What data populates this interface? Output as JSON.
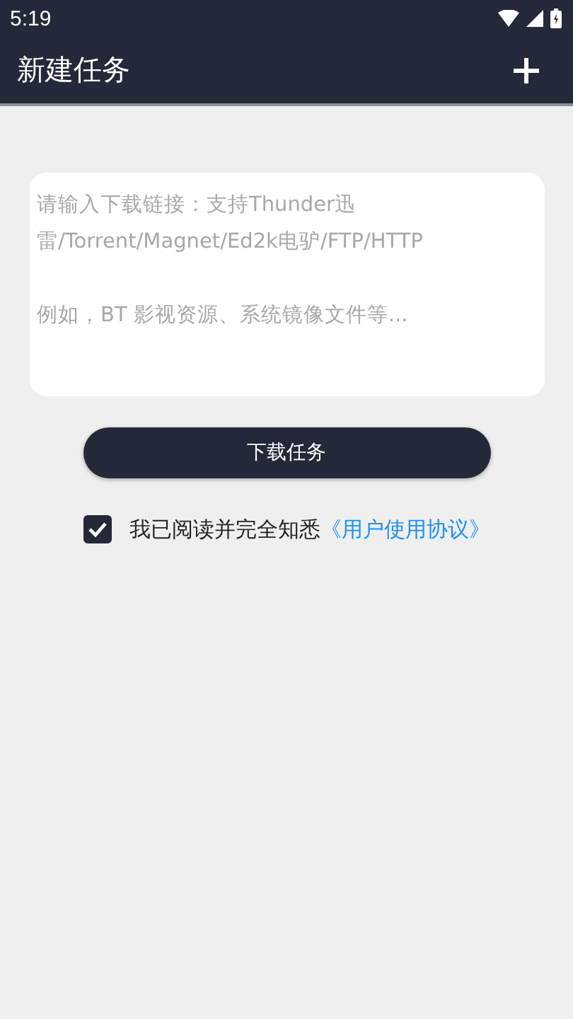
{
  "status_bar": {
    "time": "5:19"
  },
  "app_bar": {
    "title": "新建任务"
  },
  "link_input": {
    "placeholder": "请输入下载链接：支持Thunder迅雷/Torrent/Magnet/Ed2k电驴/FTP/HTTP\n\n例如，BT 影视资源、系统镜像文件等..."
  },
  "submit_button": {
    "label": "下载任务"
  },
  "agreement": {
    "checked": true,
    "text": "我已阅读并完全知悉",
    "link": "《用户使用协议》"
  }
}
